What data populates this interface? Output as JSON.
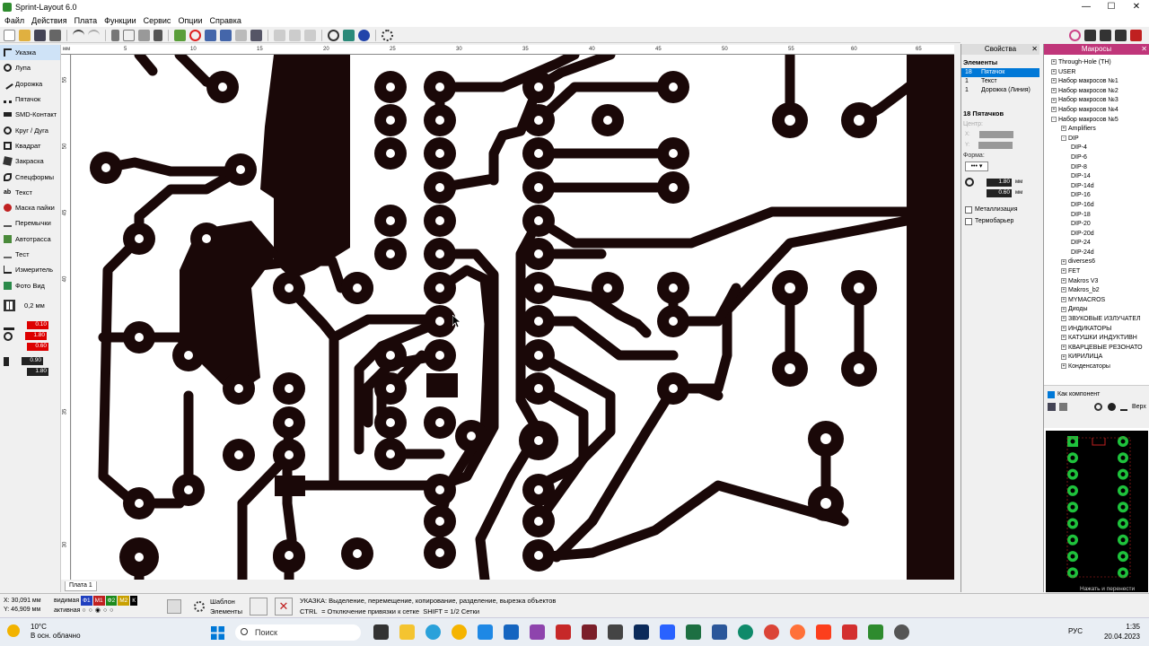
{
  "window": {
    "title": "Sprint-Layout 6.0",
    "min": "—",
    "max": "☐",
    "close": "✕"
  },
  "menu": [
    "Файл",
    "Действия",
    "Плата",
    "Функции",
    "Сервис",
    "Опции",
    "Справка"
  ],
  "ruler": {
    "unit": "мм",
    "h_ticks": [
      "5",
      "10",
      "15",
      "20",
      "25",
      "30",
      "35",
      "40",
      "45",
      "50",
      "55",
      "60",
      "65"
    ],
    "v_ticks": [
      "55",
      "50",
      "45",
      "40",
      "35",
      "30"
    ]
  },
  "tools": [
    {
      "label": "Указка",
      "icon": "pointer-icon",
      "active": true
    },
    {
      "label": "Лупа",
      "icon": "magnifier-icon"
    },
    {
      "label": "Дорожка",
      "icon": "track-icon"
    },
    {
      "label": "Пятачок",
      "icon": "pad-icon"
    },
    {
      "label": "SMD-Контакт",
      "icon": "smd-icon"
    },
    {
      "label": "Круг / Дуга",
      "icon": "circle-icon"
    },
    {
      "label": "Квадрат",
      "icon": "square-icon"
    },
    {
      "label": "Закраска",
      "icon": "fill-icon"
    },
    {
      "label": "Спецформы",
      "icon": "specforms-icon"
    },
    {
      "label": "Текст",
      "icon": "text-icon"
    },
    {
      "label": "Маска пайки",
      "icon": "solder-mask-icon"
    },
    {
      "label": "Перемычки",
      "icon": "jumper-icon"
    },
    {
      "label": "Автотрасса",
      "icon": "autoroute-icon"
    },
    {
      "label": "Тест",
      "icon": "test-icon"
    },
    {
      "label": "Измеритель",
      "icon": "ruler-icon"
    },
    {
      "label": "Фото Вид",
      "icon": "photo-icon"
    }
  ],
  "grid": {
    "value": "0,2 мм"
  },
  "widths": {
    "track": "0.10",
    "pad_outer": "1.80",
    "pad_inner": "0.60",
    "smd_w": "0.90",
    "smd_h": "1.80"
  },
  "board_tab": "Плата 1",
  "properties": {
    "title": "Свойства",
    "elements_label": "Элементы",
    "elements": [
      {
        "count": "18",
        "name": "Пятачок",
        "selected": true
      },
      {
        "count": "1",
        "name": "Текст",
        "selected": false
      },
      {
        "count": "1",
        "name": "Дорожка (Линия)",
        "selected": false
      }
    ],
    "group_title": "18 Пятачков",
    "center_label": "Центр:",
    "x_label": "X:",
    "y_label": "Y:",
    "shape_label": "Форма:",
    "outer": "1.80",
    "inner": "0.60",
    "unit": "мм",
    "metallization": "Металлизация",
    "thermal": "Термобарьер"
  },
  "macros": {
    "title": "Макросы",
    "tree": [
      {
        "label": "Through-Hole (TH)",
        "level": 0,
        "expander": "+"
      },
      {
        "label": "USER",
        "level": 0,
        "expander": "+"
      },
      {
        "label": "Набор макросов №1",
        "level": 0,
        "expander": "+"
      },
      {
        "label": "Набор макросов №2",
        "level": 0,
        "expander": "+"
      },
      {
        "label": "Набор макросов №3",
        "level": 0,
        "expander": "+"
      },
      {
        "label": "Набор макросов №4",
        "level": 0,
        "expander": "+"
      },
      {
        "label": "Набор макросов №5",
        "level": 0,
        "expander": "-"
      },
      {
        "label": "Amplifiers",
        "level": 1,
        "expander": "+"
      },
      {
        "label": "DIP",
        "level": 1,
        "expander": "-"
      },
      {
        "label": "DIP-4",
        "level": 2,
        "expander": ""
      },
      {
        "label": "DIP-6",
        "level": 2,
        "expander": ""
      },
      {
        "label": "DIP-8",
        "level": 2,
        "expander": ""
      },
      {
        "label": "DIP-14",
        "level": 2,
        "expander": ""
      },
      {
        "label": "DIP-14d",
        "level": 2,
        "expander": ""
      },
      {
        "label": "DIP-16",
        "level": 2,
        "expander": ""
      },
      {
        "label": "DIP-16d",
        "level": 2,
        "expander": ""
      },
      {
        "label": "DIP-18",
        "level": 2,
        "expander": ""
      },
      {
        "label": "DIP-20",
        "level": 2,
        "expander": ""
      },
      {
        "label": "DIP-20d",
        "level": 2,
        "expander": ""
      },
      {
        "label": "DIP-24",
        "level": 2,
        "expander": ""
      },
      {
        "label": "DIP-24d",
        "level": 2,
        "expander": ""
      },
      {
        "label": "diverses6",
        "level": 1,
        "expander": "+"
      },
      {
        "label": "FET",
        "level": 1,
        "expander": "+"
      },
      {
        "label": "Makros V3",
        "level": 1,
        "expander": "+"
      },
      {
        "label": "Makros_b2",
        "level": 1,
        "expander": "+"
      },
      {
        "label": "MYMACROS",
        "level": 1,
        "expander": "+"
      },
      {
        "label": "Диоды",
        "level": 1,
        "expander": "+"
      },
      {
        "label": "ЗВУКОВЫЕ ИЗЛУЧАТЕЛ",
        "level": 1,
        "expander": "+"
      },
      {
        "label": "ИНДИКАТОРЫ",
        "level": 1,
        "expander": "+"
      },
      {
        "label": "КАТУШКИ ИНДУКТИВН",
        "level": 1,
        "expander": "+"
      },
      {
        "label": "КВАРЦЕВЫЕ РЕЗОНАТО",
        "level": 1,
        "expander": "+"
      },
      {
        "label": "КИРИЛИЦА",
        "level": 1,
        "expander": "+"
      },
      {
        "label": "Конденсаторы",
        "level": 1,
        "expander": "+"
      }
    ],
    "as_component": "Как компонент",
    "top_label": "Верх",
    "preview_hint": "Нажать и перенести"
  },
  "status": {
    "x": "X: 30,091 мм",
    "y": "Y: 46,909 мм",
    "visible": "видимая",
    "active": "активная",
    "layers": [
      {
        "name": "Ф1",
        "color": "#1f3fbf"
      },
      {
        "name": "М1",
        "color": "#c02020"
      },
      {
        "name": "Ф2",
        "color": "#1d8a1d"
      },
      {
        "name": "М2",
        "color": "#c8a000"
      },
      {
        "name": "К",
        "color": "#000000"
      }
    ],
    "template_line1": "Шаблон",
    "template_line2": "Элементы",
    "message": "УКАЗКА: Выделение, перемещение, копирование, разделение, вырезка объектов",
    "ctrl_key": "CTRL",
    "ctrl_text": "= Отключение привязки к сетке",
    "shift_key": "SHIFT",
    "shift_text": "= 1/2 Сетки"
  },
  "taskbar": {
    "temp": "10°C",
    "weather": "В осн. облачно",
    "search": "Поиск",
    "lang": "РУС",
    "time": "1:35",
    "date": "20.04.2023"
  },
  "colors": {
    "copper": "#1a0808",
    "board": "#ffffff",
    "selection": "#0078d7",
    "macros_head": "#c0367a",
    "preview_pad": "#1ec23c"
  }
}
